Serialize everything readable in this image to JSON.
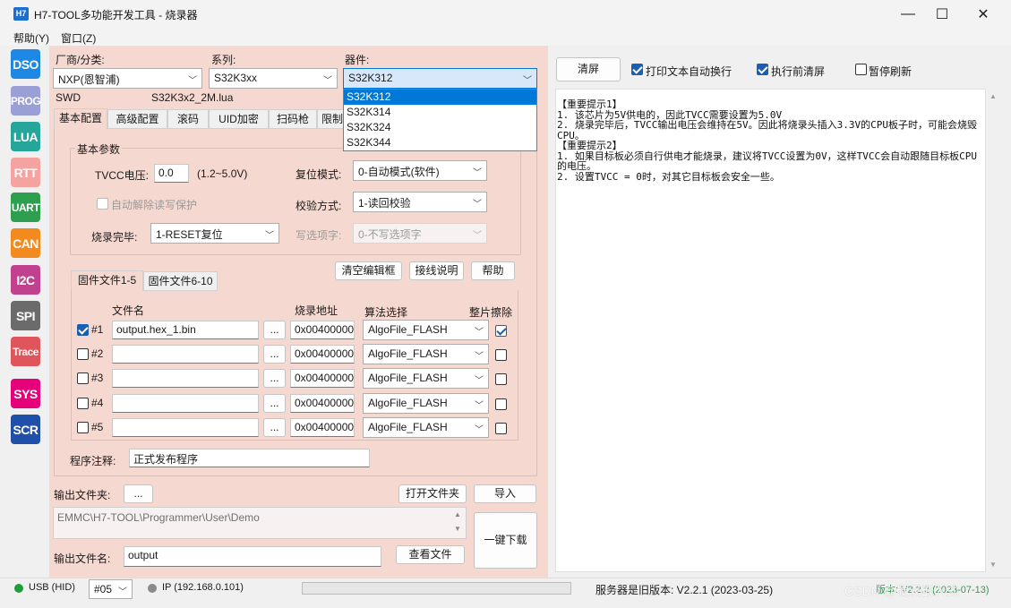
{
  "window": {
    "icon_text": "H7",
    "title": "H7-TOOL多功能开发工具 - 烧录器",
    "minimize": "—",
    "maximize": "☐",
    "close": "✕"
  },
  "menu": [
    "帮助(Y)",
    "窗口(Z)"
  ],
  "nav": [
    {
      "label": "DSO",
      "color": "#1e88e5"
    },
    {
      "label": "PROG",
      "color": "#9aa0d6"
    },
    {
      "label": "LUA",
      "color": "#26a69a"
    },
    {
      "label": "RTT",
      "color": "#f4a3a0"
    },
    {
      "label": "UART",
      "color": "#2e9e4f"
    },
    {
      "label": "CAN",
      "color": "#f28a1e"
    },
    {
      "label": "I2C",
      "color": "#c0418d"
    },
    {
      "label": "SPI",
      "color": "#6b6b6b"
    },
    {
      "label": "Trace",
      "color": "#e0555c"
    },
    {
      "label": "SYS",
      "color": "#e6007a"
    },
    {
      "label": "SCR",
      "color": "#1f4fa8"
    }
  ],
  "selectors": {
    "vendor_label": "厂商/分类:",
    "vendor_value": "NXP(恩智浦)",
    "series_label": "系列:",
    "series_value": "S32K3xx",
    "device_label": "器件:",
    "device_value": "S32K312",
    "device_options": [
      "S32K312",
      "S32K314",
      "S32K324",
      "S32K344"
    ],
    "interface": "SWD",
    "script": "S32K3x2_2M.lua"
  },
  "tabs": [
    "基本配置",
    "高级配置",
    "滚码",
    "UID加密",
    "扫码枪",
    "限制"
  ],
  "basic": {
    "group_title": "基本参数",
    "tvcc_label": "TVCC电压:",
    "tvcc_value": "0.0",
    "tvcc_range": "(1.2~5.0V)",
    "reset_label": "复位模式:",
    "reset_value": "0-自动模式(软件)",
    "auto_unprotect": "自动解除读写保护",
    "verify_label": "校验方式:",
    "verify_value": "1-读回校验",
    "after_label": "烧录完毕:",
    "after_value": "1-RESET复位",
    "option_label": "写选项字:",
    "option_value": "0-不写选项字"
  },
  "file_buttons": {
    "clear": "清空编辑框",
    "wiring": "接线说明",
    "help": "帮助"
  },
  "file_tabs": [
    "固件文件1-5",
    "固件文件6-10"
  ],
  "file_table": {
    "headers": {
      "name": "文件名",
      "addr": "烧录地址",
      "algo": "算法选择",
      "erase": "整片擦除"
    },
    "browse": "...",
    "rows": [
      {
        "id": "#1",
        "checked": true,
        "file": "output.hex_1.bin",
        "addr": "0x00400000",
        "algo": "AlgoFile_FLASH",
        "erase": true
      },
      {
        "id": "#2",
        "checked": false,
        "file": "",
        "addr": "0x00400000",
        "algo": "AlgoFile_FLASH",
        "erase": false
      },
      {
        "id": "#3",
        "checked": false,
        "file": "",
        "addr": "0x00400000",
        "algo": "AlgoFile_FLASH",
        "erase": false
      },
      {
        "id": "#4",
        "checked": false,
        "file": "",
        "addr": "0x00400000",
        "algo": "AlgoFile_FLASH",
        "erase": false
      },
      {
        "id": "#5",
        "checked": false,
        "file": "",
        "addr": "0x00400000",
        "algo": "AlgoFile_FLASH",
        "erase": false
      }
    ]
  },
  "note": {
    "label": "程序注释:",
    "value": "正式发布程序"
  },
  "output": {
    "folder_label": "输出文件夹:",
    "folder_btn": "...",
    "open_folder": "打开文件夹",
    "import": "导入",
    "path": "EMMC\\H7-TOOL\\Programmer\\User\\Demo",
    "name_label": "输出文件名:",
    "name_value": "output",
    "view_file": "查看文件",
    "one_click": "一键下载"
  },
  "right": {
    "clear": "清屏",
    "auto_wrap": "打印文本自动换行",
    "clear_before": "执行前清屏",
    "pause": "暂停刷新",
    "log": [
      "【重要提示1】",
      "1. 该芯片为5V供电的，因此TVCC需要设置为5.0V",
      "2. 烧录完毕后，TVCC输出电压会维持在5V。因此将烧录头插入3.3V的CPU板子时，可能会烧毁CPU。",
      "",
      "【重要提示2】",
      "1. 如果目标板必须自行供电才能烧录，建议将TVCC设置为0V，这样TVCC会自动跟随目标板CPU的电压。",
      "2. 设置TVCC = 0时，对其它目标板会安全一些。"
    ]
  },
  "status": {
    "usb": "USB (HID)",
    "device_no": "#05",
    "ip": "IP (192.168.0.101)",
    "server": "服务器是旧版本: V2.2.1 (2023-03-25)",
    "version": "版本: V2.2.2 (2023-07-13)",
    "watermark": "CSDN @硬汉嵌入式"
  }
}
